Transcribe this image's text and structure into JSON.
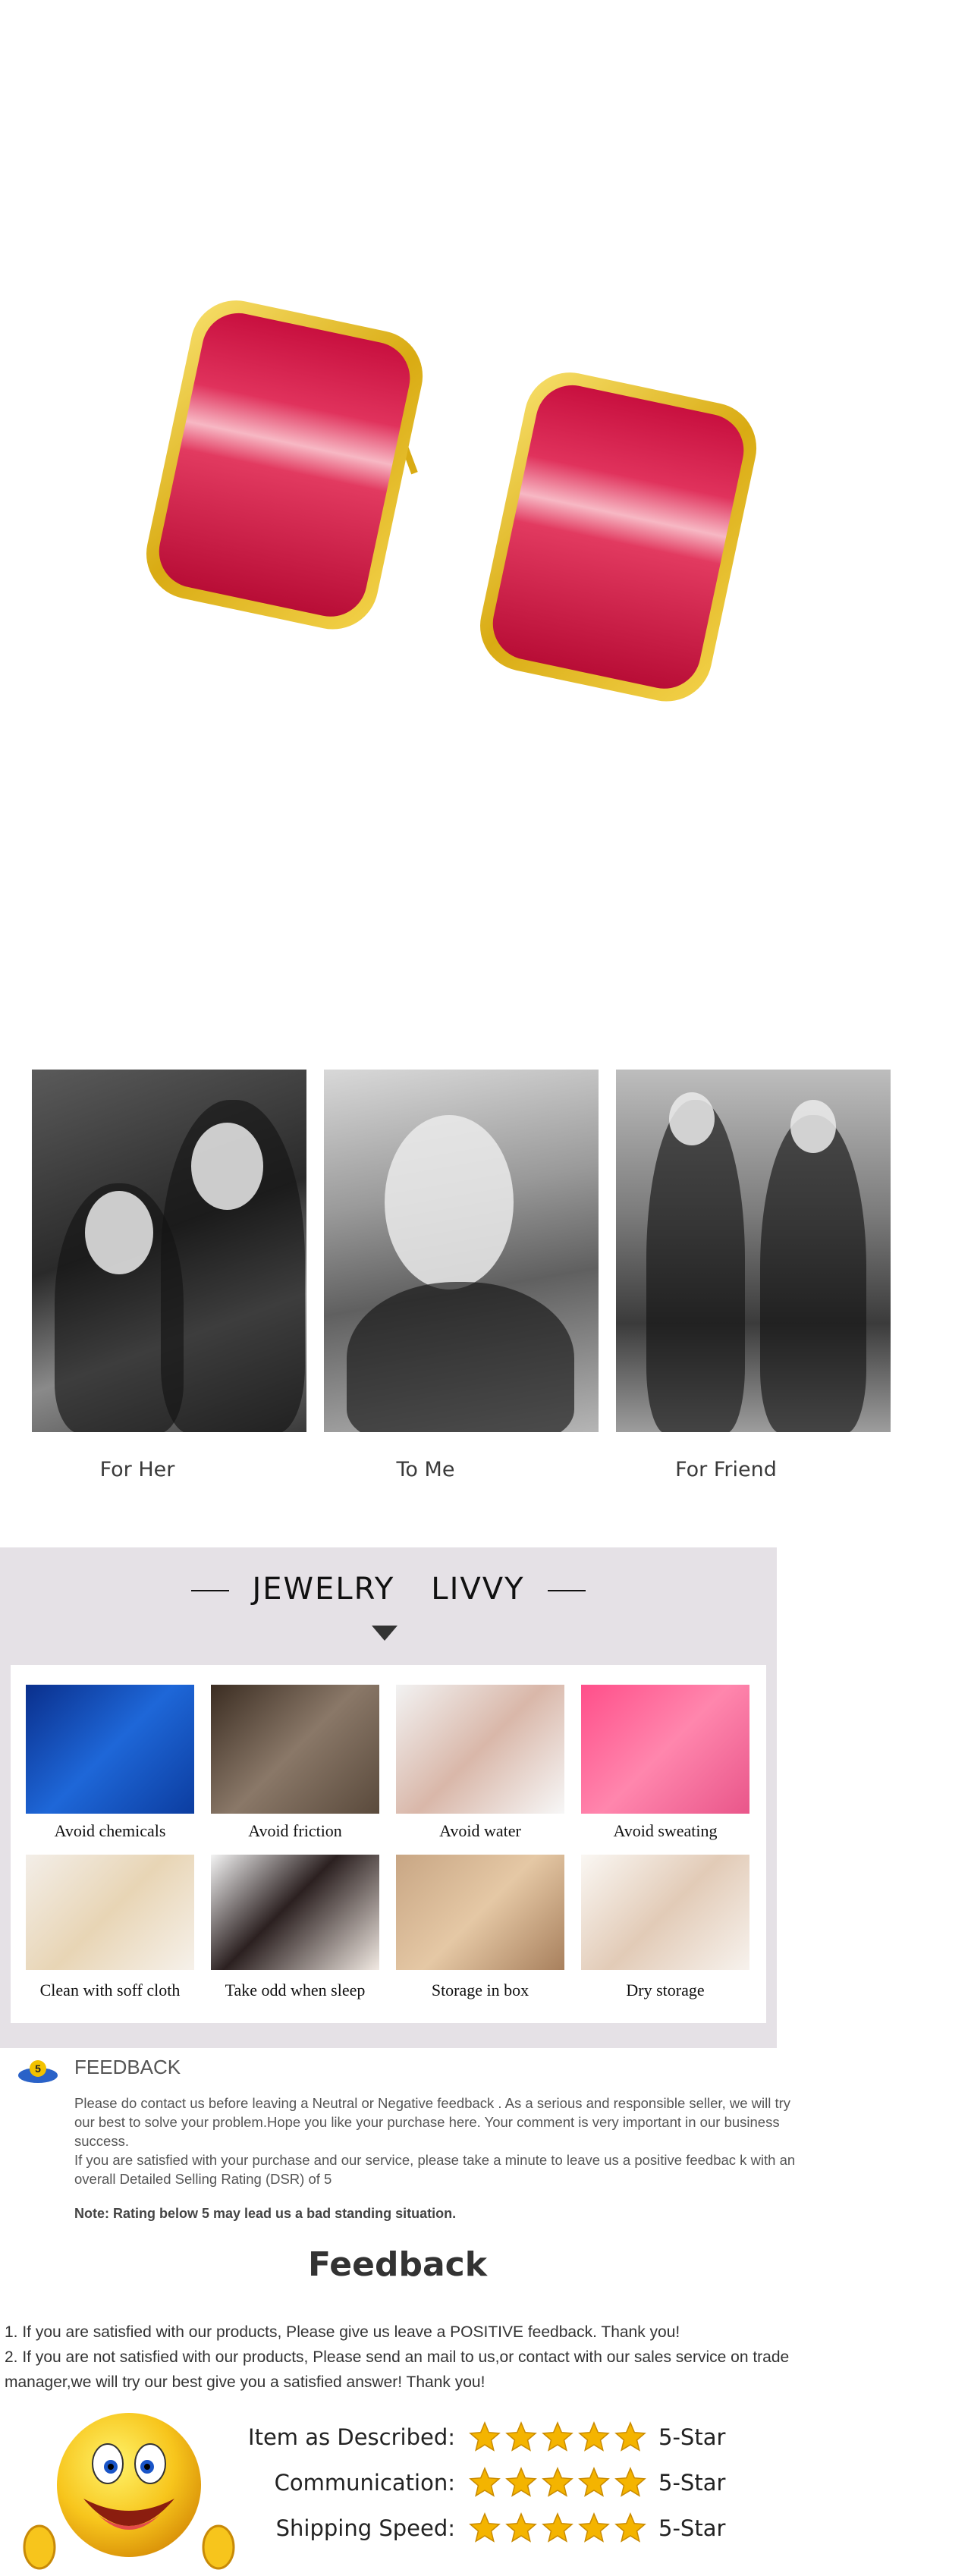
{
  "hero": {
    "image_label": "red enamel gold earrings"
  },
  "occasions": [
    {
      "label": "For Her"
    },
    {
      "label": "To Me"
    },
    {
      "label": "For Friend"
    }
  ],
  "care": {
    "title_left": "JEWELRY",
    "title_right": "LIVVY",
    "items": [
      {
        "label": "Avoid chemicals"
      },
      {
        "label": "Avoid friction"
      },
      {
        "label": "Avoid water"
      },
      {
        "label": "Avoid sweating"
      },
      {
        "label": "Clean with soff cloth"
      },
      {
        "label": "Take odd when sleep"
      },
      {
        "label": "Storage in box"
      },
      {
        "label": "Dry storage"
      }
    ]
  },
  "notice": {
    "badge": "5",
    "title": "FEEDBACK",
    "paragraph1": "Please do contact us before leaving a Neutral or Negative  feedback . As a serious and responsible seller, we will try our best to solve your problem.Hope you like your purchase here. Your comment is very important in our business success.",
    "paragraph2": " If you are satisfied with your purchase and our service,  please take a minute to leave us  a positive feedbac k with an overall  Detailed Selling Rating (DSR) of 5",
    "note": "Note: Rating below 5 may lead us a bad standing situation."
  },
  "feedback": {
    "heading": "Feedback",
    "line1": "1. If you are satisfied with our products, Please give us leave a POSITIVE feedback. Thank you!",
    "line2": "2. If you are not satisfied with our products, Please send an mail to us,or contact with our sales service on trade manager,we will try our best give you a satisfied answer! Thank you!"
  },
  "ratings": [
    {
      "label": "Item as Described:",
      "stars": 5,
      "value": "5-Star"
    },
    {
      "label": "Communication:",
      "stars": 5,
      "value": "5-Star"
    },
    {
      "label": "Shipping Speed:",
      "stars": 5,
      "value": "5-Star"
    }
  ],
  "colors": {
    "enamel": "#d4154a",
    "gold": "#e8c02a",
    "panel_bg": "#e5e1e6",
    "star": "#f4b400"
  }
}
